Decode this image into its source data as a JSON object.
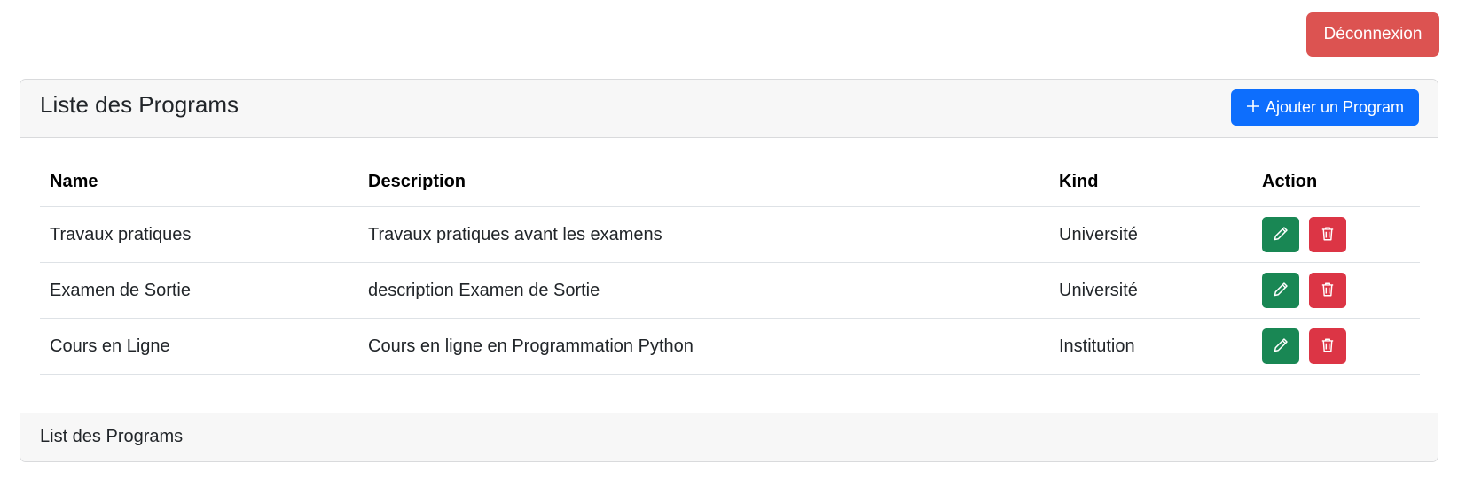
{
  "header": {
    "logout_label": "Déconnexion"
  },
  "card": {
    "title": "Liste des Programs",
    "add_button_label": "Ajouter un Program",
    "footer_text": "List des Programs"
  },
  "table": {
    "columns": [
      "Name",
      "Description",
      "Kind",
      "Action"
    ],
    "rows": [
      {
        "name": "Travaux pratiques",
        "description": "Travaux pratiques avant les examens",
        "kind": "Université"
      },
      {
        "name": "Examen de Sortie",
        "description": "description Examen de Sortie",
        "kind": "Université"
      },
      {
        "name": "Cours en Ligne",
        "description": "Cours en ligne en Programmation Python",
        "kind": "Institution"
      }
    ]
  },
  "colors": {
    "logout": "#dc5351",
    "primary": "#0d6efd",
    "edit": "#198754",
    "delete": "#dc3545"
  },
  "icons": {
    "add": "plus-icon",
    "edit": "pencil-icon",
    "delete": "trash-icon"
  }
}
